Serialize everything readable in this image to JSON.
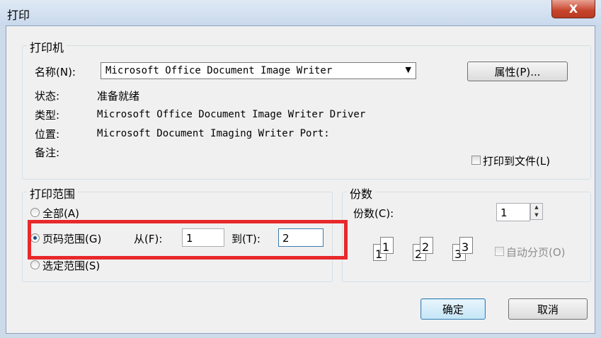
{
  "window": {
    "title": "打印",
    "close_label": "X"
  },
  "printer": {
    "group_label": "打印机",
    "name_label": "名称(N):",
    "name_value": "Microsoft Office Document Image Writer",
    "properties_button": "属性(P)...",
    "status_label": "状态:",
    "status_value": "准备就绪",
    "type_label": "类型:",
    "type_value": "Microsoft Office Document Image Writer Driver",
    "location_label": "位置:",
    "location_value": "Microsoft Document Imaging Writer Port:",
    "comment_label": "备注:",
    "print_to_file_label": "打印到文件(L)"
  },
  "range": {
    "group_label": "打印范围",
    "all_label": "全部(A)",
    "pages_label": "页码范围(G)",
    "from_label": "从(F):",
    "from_value": "1",
    "to_label": "到(T):",
    "to_value": "2",
    "selection_label": "选定范围(S)",
    "selected": "pages"
  },
  "copies": {
    "group_label": "份数",
    "count_label": "份数(C):",
    "count_value": "1",
    "collate_label": "自动分页(O)",
    "page_icons": [
      "1",
      "1",
      "2",
      "2",
      "3",
      "3"
    ]
  },
  "buttons": {
    "ok": "确定",
    "cancel": "取消"
  },
  "colors": {
    "highlight": "#e8282b",
    "close": "#c7442d"
  }
}
